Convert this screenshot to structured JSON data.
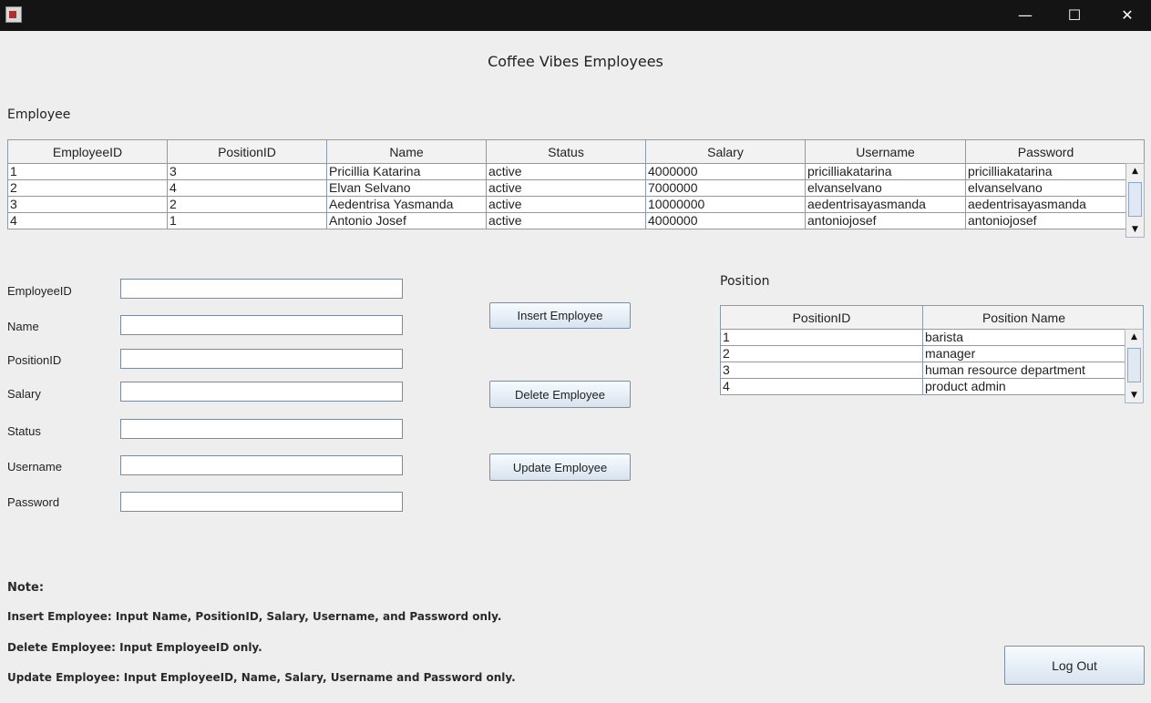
{
  "window": {
    "minimize": "—",
    "maximize": "☐",
    "close": "✕"
  },
  "title": "Coffee Vibes Employees",
  "employee": {
    "label": "Employee",
    "columns": [
      "EmployeeID",
      "PositionID",
      "Name",
      "Status",
      "Salary",
      "Username",
      "Password"
    ],
    "rows": [
      [
        "1",
        "3",
        "Pricillia Katarina",
        "active",
        "4000000",
        "pricilliakatarina",
        "pricilliakatarina"
      ],
      [
        "2",
        "4",
        "Elvan Selvano",
        "active",
        "7000000",
        "elvanselvano",
        "elvanselvano"
      ],
      [
        "3",
        "2",
        "Aedentrisa Yasmanda",
        "active",
        "10000000",
        "aedentrisayasmanda",
        "aedentrisayasmanda"
      ],
      [
        "4",
        "1",
        "Antonio Josef",
        "active",
        "4000000",
        "antoniojosef",
        "antoniojosef"
      ]
    ]
  },
  "form": {
    "employee_id_label": "EmployeeID",
    "name_label": "Name",
    "position_id_label": "PositionID",
    "salary_label": "Salary",
    "status_label": "Status",
    "username_label": "Username",
    "password_label": "Password",
    "employee_id_value": "",
    "name_value": "",
    "position_id_value": "",
    "salary_value": "",
    "status_value": "",
    "username_value": "",
    "password_value": ""
  },
  "buttons": {
    "insert": "Insert Employee",
    "delete": "Delete Employee",
    "update": "Update Employee",
    "logout": "Log Out"
  },
  "position": {
    "label": "Position",
    "columns": [
      "PositionID",
      "Position Name"
    ],
    "rows": [
      [
        "1",
        "barista"
      ],
      [
        "2",
        "manager"
      ],
      [
        "3",
        "human resource department"
      ],
      [
        "4",
        "product admin"
      ]
    ]
  },
  "notes": {
    "heading": "Note:",
    "insert": "Insert Employee: Input Name, PositionID, Salary, Username, and Password only.",
    "delete": "Delete Employee: Input EmployeeID only.",
    "update": "Update Employee: Input EmployeeID, Name, Salary, Username and Password only."
  }
}
